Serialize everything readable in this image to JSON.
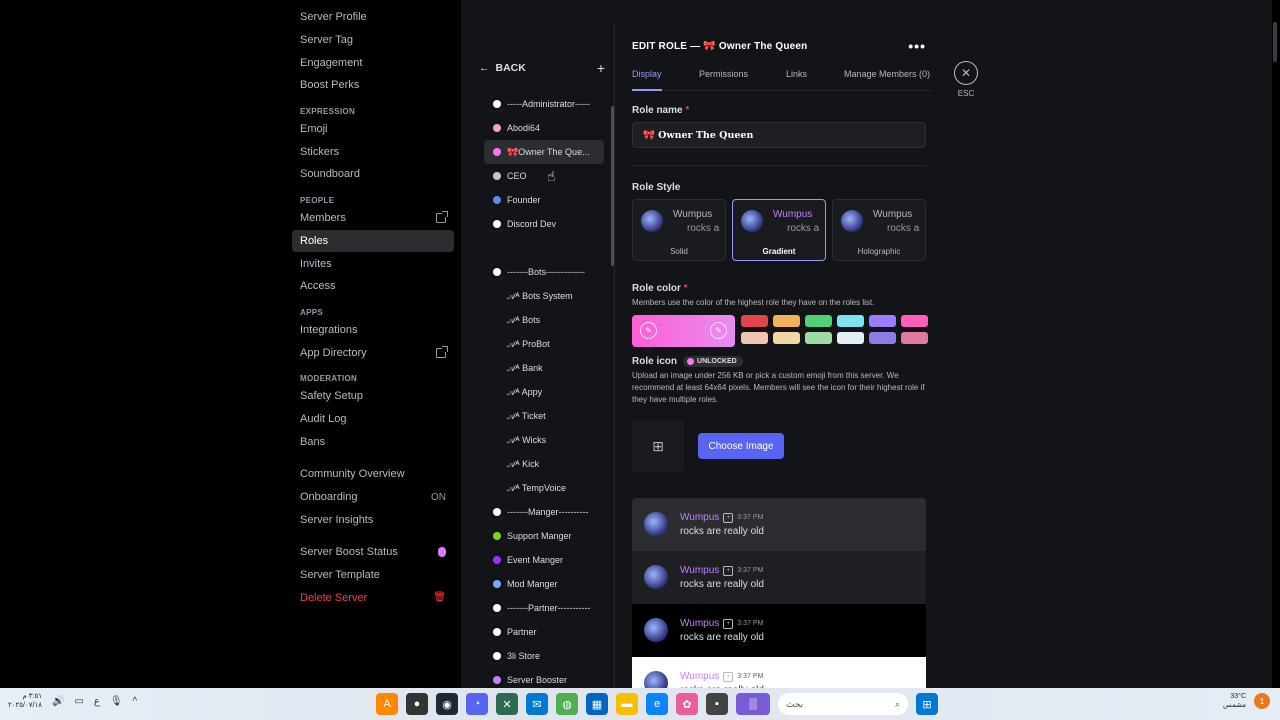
{
  "window": {
    "minimize": "—",
    "maximize": "☐",
    "close": "✕"
  },
  "sidebar": {
    "top_items": [
      "Server Profile",
      "Server Tag",
      "Engagement",
      "Boost Perks"
    ],
    "expression": {
      "heading": "EXPRESSION",
      "items": [
        "Emoji",
        "Stickers",
        "Soundboard"
      ]
    },
    "people": {
      "heading": "PEOPLE",
      "items": [
        "Members",
        "Roles",
        "Invites",
        "Access"
      ],
      "active": "Roles"
    },
    "apps": {
      "heading": "APPS",
      "items": [
        "Integrations",
        "App Directory"
      ]
    },
    "moderation": {
      "heading": "MODERATION",
      "items": [
        "Safety Setup",
        "Audit Log",
        "Bans"
      ]
    },
    "community": {
      "items": [
        "Community Overview",
        "Onboarding",
        "Server Insights"
      ],
      "onboarding_status": "ON"
    },
    "bottom": {
      "boost_status": "Server Boost Status",
      "template": "Server Template",
      "delete": "Delete Server"
    }
  },
  "roles_panel": {
    "back": "BACK",
    "add": "+",
    "roles": [
      {
        "name": "-----Administrator-----",
        "color": "#ffffff"
      },
      {
        "name": "Abodi64",
        "color": "#f7a1c4"
      },
      {
        "name": "🎀Owner The Que...",
        "color": "#ff73fa",
        "active": true
      },
      {
        "name": "CEO",
        "color": "#c8c8c8"
      },
      {
        "name": "Founder",
        "color": "#5b8def"
      },
      {
        "name": "Discord Dev",
        "color": "#ffffff"
      },
      {
        "name": "",
        "color": "#131417"
      },
      {
        "name": "-------Bots-------------",
        "color": "#ffffff"
      },
      {
        "name": "𝒜ᴬ Bots System",
        "color": "#131417"
      },
      {
        "name": "𝒜ᴬ Bots",
        "color": "#131417"
      },
      {
        "name": "𝒜ᴬ ProBot",
        "color": "#131417"
      },
      {
        "name": "𝒜ᴬ Bank",
        "color": "#131417"
      },
      {
        "name": "𝒜ᴬ Appy",
        "color": "#131417"
      },
      {
        "name": "𝒜ᴬ Ticket",
        "color": "#131417"
      },
      {
        "name": "𝒜ᴬ Wicks",
        "color": "#131417"
      },
      {
        "name": "𝒜ᴬ Kick",
        "color": "#131417"
      },
      {
        "name": "𝒜ᴬ TempVoice",
        "color": "#131417"
      },
      {
        "name": "-------Manger----------",
        "color": "#ffffff"
      },
      {
        "name": "Support Manger",
        "color": "#7ed321"
      },
      {
        "name": "Event Manger",
        "color": "#9b30ff"
      },
      {
        "name": "Mod Manger",
        "color": "#7aa7ff"
      },
      {
        "name": "-------Partner-----------",
        "color": "#ffffff"
      },
      {
        "name": "Partner",
        "color": "#ffffff"
      },
      {
        "name": "3li Store",
        "color": "#ffffff"
      },
      {
        "name": "Server Booster",
        "color": "#c77dff"
      }
    ]
  },
  "edit": {
    "title": "EDIT ROLE — 🎀 Owner The Queen",
    "more": "•••",
    "tabs": [
      "Display",
      "Permissions",
      "Links",
      "Manage Members (0)"
    ],
    "active_tab": "Display",
    "role_name_label": "Role name",
    "required": "*",
    "role_name_value": "🎀 Owner The Queen",
    "role_style_label": "Role Style",
    "style_preview_name": "Wumpus",
    "style_preview_sub": "rocks a",
    "styles": [
      "Solid",
      "Gradient",
      "Holographic"
    ],
    "active_style": "Gradient",
    "role_color_label": "Role color",
    "role_color_help": "Members use the color of the highest role they have on the roles list.",
    "gradient_colors": [
      "#ff5fd6",
      "#e88cf0"
    ],
    "swatches": [
      "#e0454d",
      "#f2b25c",
      "#4fd17a",
      "#7ee3ec",
      "#9b7bff",
      "#ff5fb8",
      "#eec6b0",
      "#f0d6a5",
      "#9fd9a4",
      "#e3eef5",
      "#8f7ae6",
      "#e07a9f"
    ],
    "role_icon_label": "Role icon",
    "unlocked": "UNLOCKED",
    "role_icon_help": "Upload an image under 256 KB or pick a custom emoji from this server. We recommend at least 64x64 pixels. Members will see the icon for their highest role if they have multiple roles.",
    "choose_image": "Choose Image"
  },
  "preview": {
    "rows": [
      {
        "author": "Wumpus",
        "time": "3:37 PM",
        "message": "rocks are really old",
        "bg": "#2b2d31"
      },
      {
        "author": "Wumpus",
        "time": "3:37 PM",
        "message": "rocks are really old",
        "bg": "#1e1f22"
      },
      {
        "author": "Wumpus",
        "time": "3:37 PM",
        "message": "rocks are really old",
        "bg": "#000000"
      },
      {
        "author": "Wumpus",
        "time": "3:37 PM",
        "message": "rocks are really old",
        "bg": "#ffffff"
      }
    ]
  },
  "esc": {
    "icon": "✕",
    "label": "ESC"
  },
  "taskbar": {
    "time": "٣:٥١ م",
    "date": "٢٠٢٥/٠٧/١٨",
    "lang": "ع",
    "search_placeholder": "بحث",
    "weather_temp": "33°C",
    "weather_desc": "مشمس",
    "notif_count": "1"
  }
}
